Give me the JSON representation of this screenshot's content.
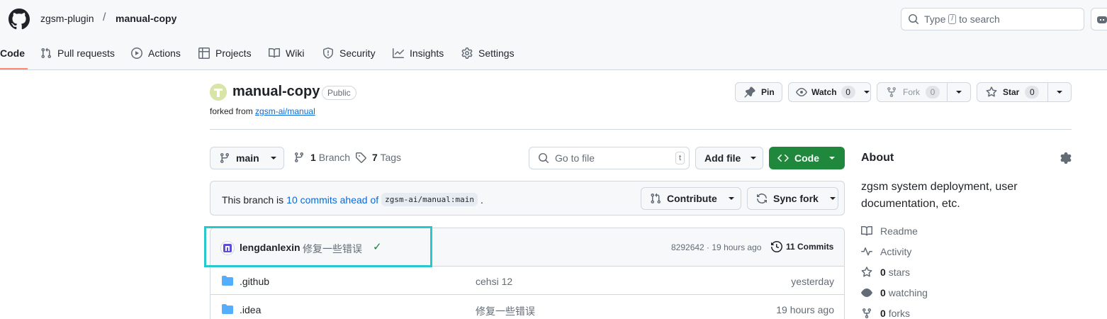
{
  "header": {
    "owner": "zgsm-plugin",
    "separator": "/",
    "repo": "manual-copy",
    "search": {
      "prefix": "Type",
      "key": "/",
      "suffix": "to search"
    }
  },
  "nav": {
    "tabs": [
      {
        "label": "Code",
        "icon": "code-icon",
        "selected": true
      },
      {
        "label": "Pull requests",
        "icon": "pull-request-icon"
      },
      {
        "label": "Actions",
        "icon": "play-icon"
      },
      {
        "label": "Projects",
        "icon": "table-icon"
      },
      {
        "label": "Wiki",
        "icon": "book-icon"
      },
      {
        "label": "Security",
        "icon": "shield-icon"
      },
      {
        "label": "Insights",
        "icon": "graph-icon"
      },
      {
        "label": "Settings",
        "icon": "gear-icon"
      }
    ]
  },
  "repo": {
    "name": "manual-copy",
    "visibility": "Public",
    "forked_prefix": "forked from",
    "forked_source": "zgsm-ai/manual",
    "pin_label": "Pin",
    "watch_label": "Watch",
    "watch_count": "0",
    "fork_label": "Fork",
    "fork_count": "0",
    "star_label": "Star",
    "star_count": "0"
  },
  "toolbar": {
    "branch": "main",
    "branch_count": "1",
    "branch_label": "Branch",
    "tag_count": "7",
    "tag_label": "Tags",
    "go_to_file": "Go to file",
    "go_to_file_key": "t",
    "add_file": "Add file",
    "code_button": "Code"
  },
  "banner": {
    "prefix": "This branch is",
    "link": "10 commits ahead of",
    "ref": "zgsm-ai/manual:main",
    "suffix": ".",
    "contribute": "Contribute",
    "sync_fork": "Sync fork"
  },
  "latest_commit": {
    "author": "lengdanlexin",
    "message": "修复一些错误",
    "status": "✓",
    "hash_time": "8292642 · 19 hours ago",
    "commits_label": "11 Commits"
  },
  "files": [
    {
      "name": ".github",
      "message": "cehsi 12",
      "time": "yesterday"
    },
    {
      "name": ".idea",
      "message": "修复一些错误",
      "time": "19 hours ago"
    }
  ],
  "about": {
    "title": "About",
    "description": "zgsm system deployment, user documentation, etc.",
    "readme": "Readme",
    "activity": "Activity",
    "stars_count": "0",
    "stars_label": "stars",
    "watching_count": "0",
    "watching_label": "watching",
    "forks_count": "0",
    "forks_label": "forks"
  },
  "colors": {
    "accent_underline": "#fd8c73",
    "link": "#0969da",
    "code_button": "#1f883d",
    "highlight_box": "#27c9cc",
    "folder": "#54aeff"
  }
}
